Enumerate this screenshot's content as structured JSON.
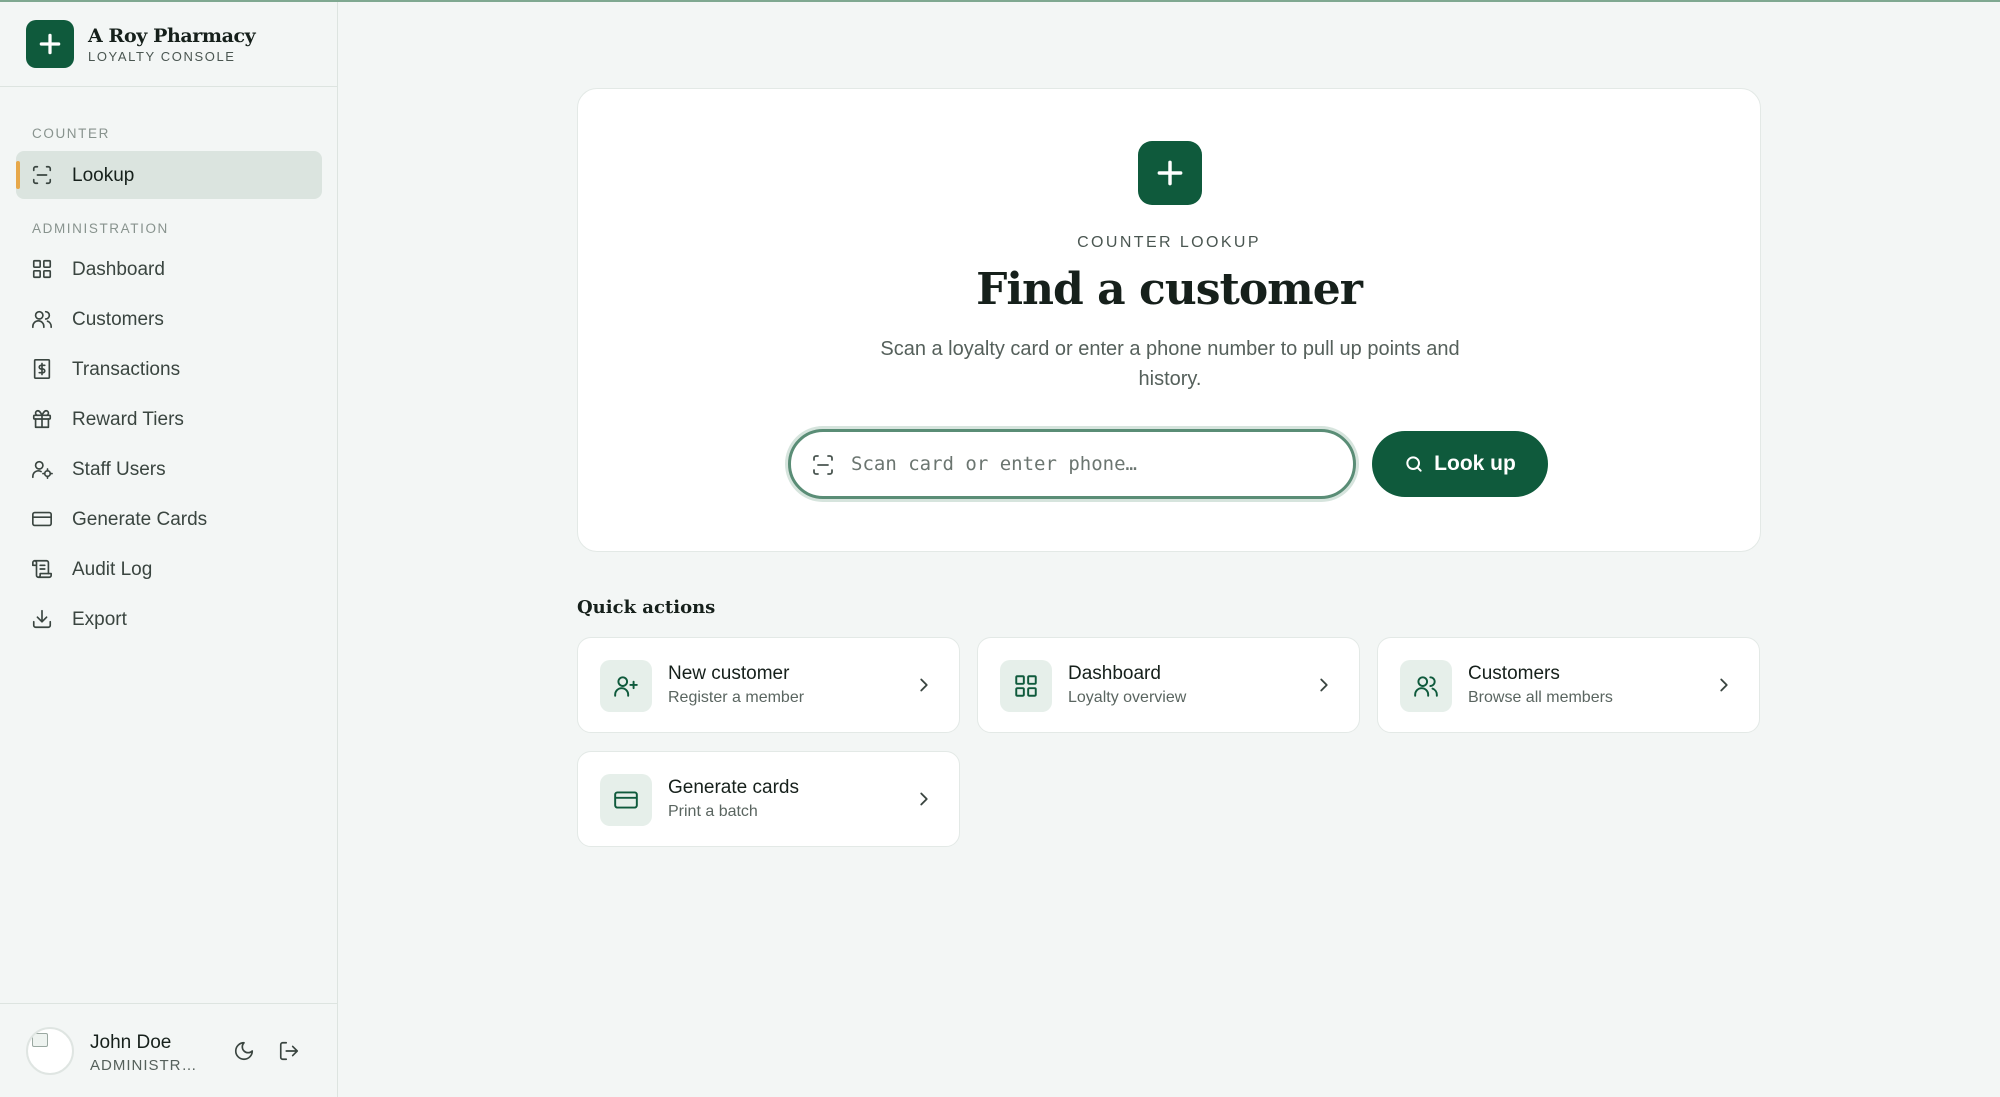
{
  "brand": {
    "name": "A Roy Pharmacy",
    "subtitle": "LOYALTY CONSOLE",
    "color": "#0f5a3c"
  },
  "sidebar": {
    "sections": [
      {
        "label": "COUNTER"
      },
      {
        "label": "ADMINISTRATION"
      }
    ],
    "items": [
      {
        "label": "Lookup",
        "icon": "scan-icon",
        "active": true
      },
      {
        "label": "Dashboard",
        "icon": "grid-icon"
      },
      {
        "label": "Customers",
        "icon": "users-icon"
      },
      {
        "label": "Transactions",
        "icon": "receipt-icon"
      },
      {
        "label": "Reward Tiers",
        "icon": "gift-icon"
      },
      {
        "label": "Staff Users",
        "icon": "user-gear-icon"
      },
      {
        "label": "Generate Cards",
        "icon": "credit-card-icon"
      },
      {
        "label": "Audit Log",
        "icon": "scroll-icon"
      },
      {
        "label": "Export",
        "icon": "download-icon"
      }
    ],
    "accent_color": "#e7a84a"
  },
  "user": {
    "name": "John Doe",
    "role": "ADMINISTRATOR"
  },
  "hero": {
    "eyebrow": "COUNTER LOOKUP",
    "title": "Find a customer",
    "description": "Scan a loyalty card or enter a phone number to pull up points and history.",
    "search": {
      "placeholder": "Scan card or enter phone…",
      "value": ""
    },
    "button_label": "Look up"
  },
  "quick_actions": {
    "heading": "Quick actions",
    "items": [
      {
        "title": "New customer",
        "subtitle": "Register a member",
        "icon": "user-plus-icon"
      },
      {
        "title": "Dashboard",
        "subtitle": "Loyalty overview",
        "icon": "grid-icon"
      },
      {
        "title": "Customers",
        "subtitle": "Browse all members",
        "icon": "users-icon"
      },
      {
        "title": "Generate cards",
        "subtitle": "Print a batch",
        "icon": "credit-card-icon"
      }
    ]
  }
}
